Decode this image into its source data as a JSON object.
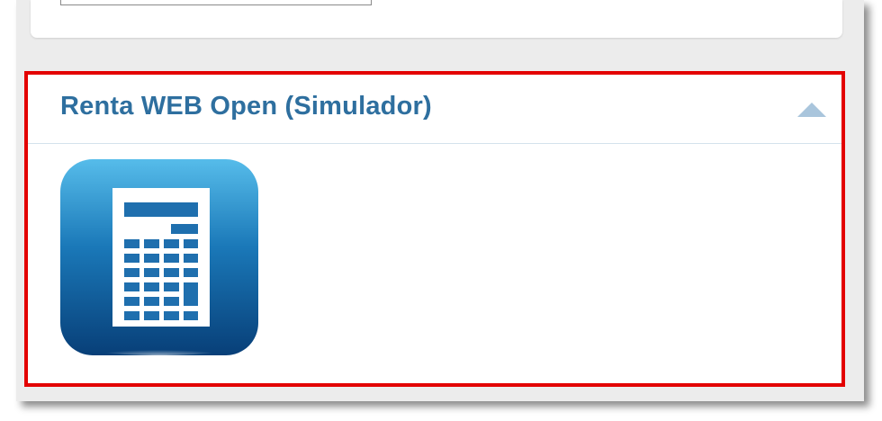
{
  "section": {
    "title": "Renta WEB Open (Simulador)"
  },
  "icons": {
    "collapse": "chevron-up-icon",
    "app": "calculator-icon"
  },
  "colors": {
    "title": "#2e6f9f",
    "highlight_border": "#e30000",
    "icon_gradient_top": "#4fb6e8",
    "icon_gradient_bottom": "#0a4a86",
    "toggle": "#a9c5dc"
  }
}
